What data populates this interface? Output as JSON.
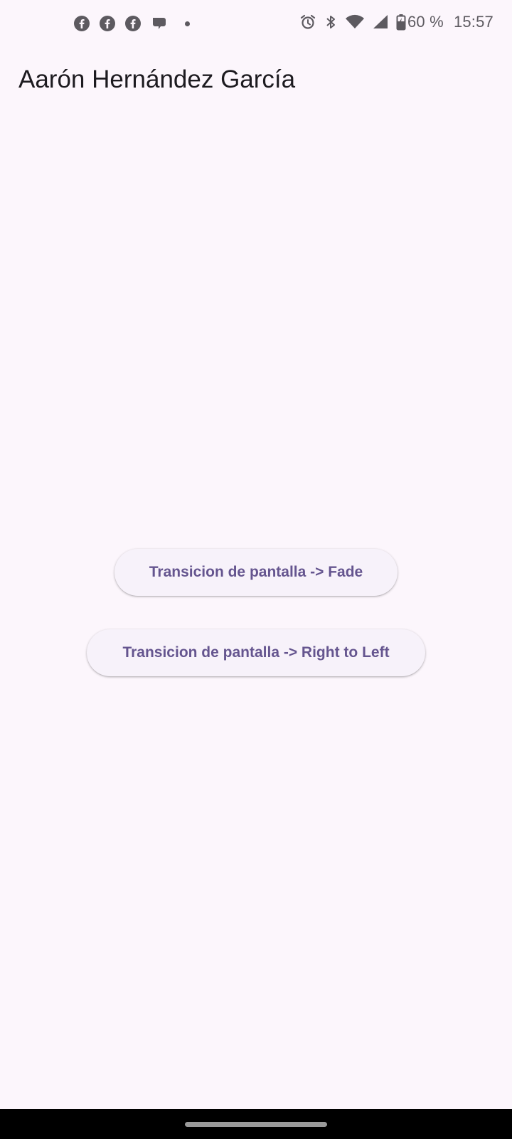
{
  "status_bar": {
    "notification_icons": [
      "facebook-icon",
      "facebook-icon",
      "facebook-icon",
      "chat-bubble-icon",
      "more-notifications-dot"
    ],
    "system_icons": [
      "alarm-icon",
      "bluetooth-icon",
      "wifi-icon",
      "cell-signal-icon",
      "battery-charging-icon"
    ],
    "battery_percent": "60 %",
    "time": "15:57"
  },
  "app_bar": {
    "title": "Aarón Hernández García"
  },
  "main": {
    "buttons": [
      {
        "label": "Transicion de pantalla -> Fade"
      },
      {
        "label": "Transicion de pantalla -> Right to Left"
      }
    ]
  },
  "colors": {
    "background": "#fcf6fc",
    "button_background": "#f7f2fa",
    "button_text": "#65558f",
    "title_text": "#1d1b20",
    "status_icons": "#5d5a60",
    "nav_bar": "#000000"
  }
}
